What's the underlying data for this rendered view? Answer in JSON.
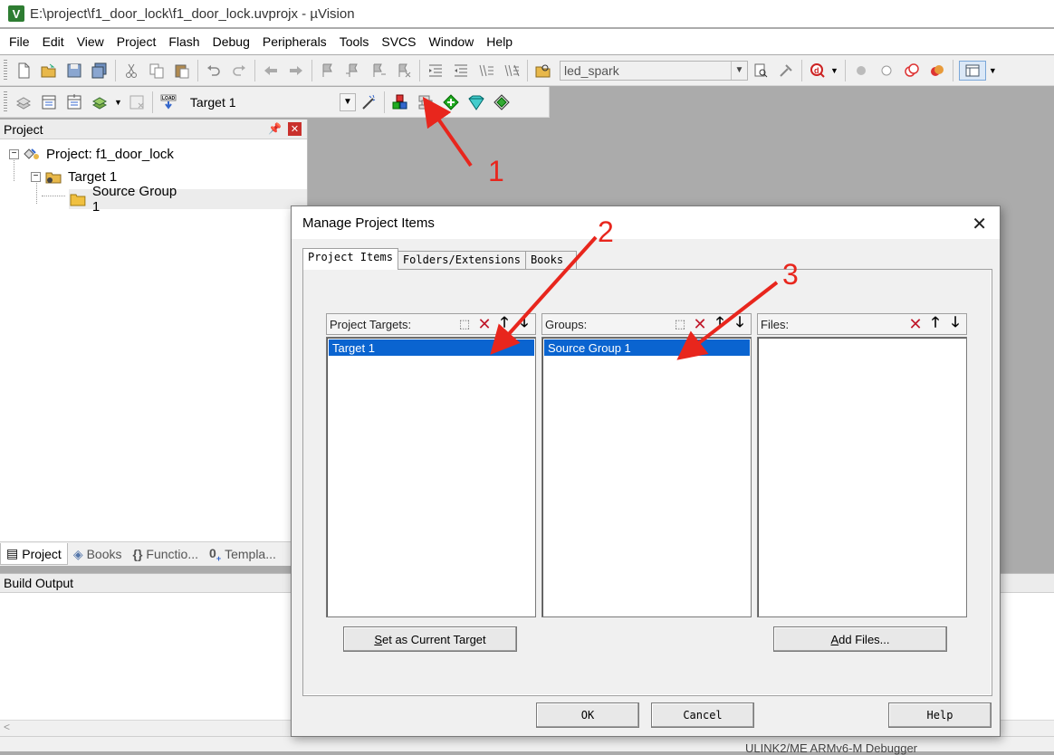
{
  "window": {
    "title": "E:\\project\\f1_door_lock\\f1_door_lock.uvprojx - µVision",
    "logo_text": "V"
  },
  "menu": [
    "File",
    "Edit",
    "View",
    "Project",
    "Flash",
    "Debug",
    "Peripherals",
    "Tools",
    "SVCS",
    "Window",
    "Help"
  ],
  "toolbar": {
    "find_combo_value": "led_spark",
    "target_select": "Target 1"
  },
  "project_panel": {
    "title": "Project",
    "tree": {
      "project": "Project: f1_door_lock",
      "target": "Target 1",
      "group": "Source Group 1"
    },
    "tabs": [
      "Project",
      "Books",
      "Functio...",
      "Templa..."
    ]
  },
  "build_output": {
    "title": "Build Output",
    "scroll_glyph": "<"
  },
  "statusbar": {
    "text": "ULINK2/ME ARMv6-M Debugger"
  },
  "dialog": {
    "title": "Manage Project Items",
    "tabs": [
      "Project Items",
      "Folders/Extensions",
      "Books"
    ],
    "targets": {
      "label": "Project Targets:",
      "items": [
        "Target 1"
      ]
    },
    "groups": {
      "label": "Groups:",
      "items": [
        "Source Group 1"
      ]
    },
    "files": {
      "label": "Files:",
      "items": []
    },
    "set_current_target": {
      "mnemonic": "S",
      "rest": "et as Current Target"
    },
    "add_files": {
      "mnemonic": "A",
      "rest": "dd Files..."
    },
    "ok": "OK",
    "cancel": "Cancel",
    "help": "Help"
  },
  "annotations": {
    "n1": "1",
    "n2": "2",
    "n3": "3",
    "color": "#e8261d"
  }
}
